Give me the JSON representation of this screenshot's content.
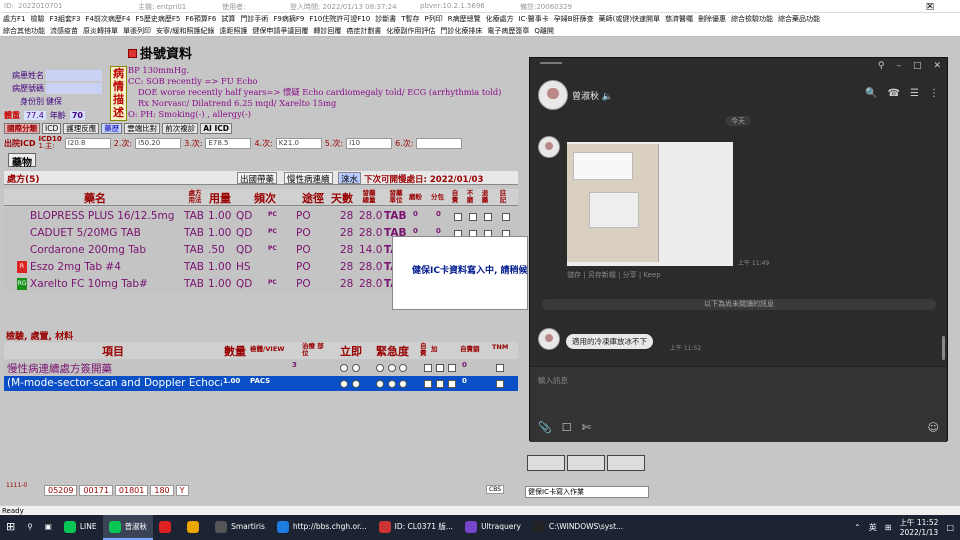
{
  "titlebar": {
    "id_label": "ID:",
    "id_val": "2022010701",
    "host": "主機: entpri01",
    "user": "使用者:",
    "login": "登入時間: 2022/01/13 08:37:24",
    "ver": "pbver:10.2.1.5696",
    "rec": "備註:20060329"
  },
  "menu": {
    "row1": [
      "處方F1",
      "檢驗",
      "F3組套F3",
      "F4前次病歷F4",
      "F5歷史病歷F5",
      "F6預算F6",
      "試算",
      "門診手術",
      "F9病摘F9",
      "F10住院許可證F10",
      "診斷書",
      "T暫存",
      "P列印",
      "R病歷總覽",
      "化療處方",
      "IC‧醫事卡",
      "孕婦B肝篩查",
      "藥師(或健)快速開單",
      "慈濟醫囑",
      "刪除優惠",
      "綜合檢驗功能",
      "綜合藥品功能"
    ],
    "row2": [
      "綜合其他功能",
      "流感疫苗",
      "原炎轉排單",
      "單張列印",
      "安寧/緩和照護紀錄",
      "遠距照護",
      "健保申請爭議回覆",
      "轉診回覆",
      "癌症計劃書",
      "化療副作用評估",
      "門診化療排床",
      "電子病歷簽章",
      "Q離開"
    ]
  },
  "form": {
    "title": "掛號資料"
  },
  "patient": {
    "name_label": "病患姓名",
    "chart_label": "病歷號碼",
    "id_label": "身份別",
    "id_value": "健保"
  },
  "vitals": {
    "ht_label": "體重",
    "ht": "77.4",
    "age_label": "年齡",
    "age": "70"
  },
  "soap": {
    "side": [
      "病",
      "情",
      "描",
      "述"
    ],
    "lines": [
      "BP 130mmHg.",
      "CC: SOB recently => FU Echo",
      "DOE worse recently half years=> 懷疑 Echo cardiomegaly told/ ECG (arrhythmia told)",
      "Rx  Norvasc/ Dilatrend 6.25 mqd/ Xarelto 15mg",
      "O: PH:   Smoking(-) , allergy(-)"
    ]
  },
  "icd_tabs": [
    "國際分類",
    "ICD",
    "護理反應",
    "藥歷",
    "雲端比對",
    "前次複診",
    "AI ICD"
  ],
  "icd": {
    "main_label": "出院ICD",
    "main_top": "ICD10",
    "main_sub": "1.主:",
    "main": "I20.8",
    "d2l": "2.次:",
    "d2": "I50.20",
    "d3l": "3.次:",
    "d3": "E78.5",
    "d4l": "4.次:",
    "d4": "K21.0",
    "d5l": "5.次:",
    "d5": "I10",
    "d6l": "6.次:",
    "d6": ""
  },
  "meds_tab": "藥物",
  "rx": {
    "label": "處方(5)",
    "btn1": "出國帶藥",
    "btn2": "慢性病連續",
    "btn3": "淶水",
    "due": "下次可開慢處日: 2022/01/03"
  },
  "rx_cols": {
    "name": "藥名",
    "route_hdr": "處方\n用法",
    "dose": "用量",
    "freq": "頻次",
    "route": "途徑",
    "days": "天數",
    "total": "發藥\n總量",
    "unit": "發藥\n單位",
    "powder": "磨粉",
    "split": "分包",
    "self": "自費",
    "self2": "不磨",
    "ref": "退藥",
    "note": "註\n記"
  },
  "rx_rows": [
    {
      "name": "BLOPRESS PLUS 16/12.5mg",
      "form": "TAB",
      "dose": "1.00",
      "freq": "QD",
      "pc": "PC",
      "route": "PO",
      "days": "28",
      "total": "28.0",
      "unit": "TAB",
      "p": "0",
      "s": "0",
      "tag": ""
    },
    {
      "name": "CADUET 5/20MG TAB",
      "form": "TAB",
      "dose": "1.00",
      "freq": "QD",
      "pc": "PC",
      "route": "PO",
      "days": "28",
      "total": "28.0",
      "unit": "TAB",
      "p": "0",
      "s": "0",
      "tag": ""
    },
    {
      "name": "Cordarone 200mg Tab",
      "form": "TAB",
      "dose": ".50",
      "freq": "QD",
      "pc": "PC",
      "route": "PO",
      "days": "28",
      "total": "14.0",
      "unit": "TA",
      "p": "",
      "s": "",
      "tag": ""
    },
    {
      "name": "Eszo 2mg Tab #4",
      "form": "TAB",
      "dose": "1.00",
      "freq": "HS",
      "pc": "",
      "route": "PO",
      "days": "28",
      "total": "28.0",
      "unit": "TA",
      "p": "",
      "s": "",
      "tag": "R"
    },
    {
      "name": "Xarelto FC 10mg Tab#",
      "form": "TAB",
      "dose": "1.00",
      "freq": "QD",
      "pc": "PC",
      "route": "PO",
      "days": "28",
      "total": "28.0",
      "unit": "TA",
      "p": "",
      "s": "",
      "tag": "RG"
    }
  ],
  "orders": {
    "label": "檢驗, 處置, 材料",
    "col_item": "項目",
    "col_qty": "數量",
    "col_view": "檢體/VIEW",
    "col_site": "治療\n部位",
    "col_stat": "立即",
    "col_urg": "緊急度",
    "col_self": "自費",
    "col_extra": "加",
    "col_fee": "自費額",
    "col_tnm": "TNM"
  },
  "order_rows": [
    {
      "item": "慢性病連續處方簽開藥",
      "qty": "",
      "view": "",
      "site": "3",
      "fee": "0",
      "selected": false
    },
    {
      "item": "(M-mode-sector-scan and Doppler Echoca",
      "qty": "1.00",
      "view": "PACS",
      "site": "",
      "fee": "0",
      "selected": true
    }
  ],
  "bottom": {
    "tiny": "1111-0",
    "nums": [
      "05209",
      "00171",
      "01801",
      "180",
      "Y"
    ],
    "cbs": "CBS"
  },
  "popup": {
    "text": "健保IC卡資料寫入中, 請稍候"
  },
  "ic_panel": {
    "label": "健保IC卡寫入作業"
  },
  "line": {
    "contact": "曾淑秋",
    "today": "今天",
    "img_time": "上午 11:49",
    "img_actions": "儲存 | 另存新檔 | 分享 | Keep",
    "unread": "以下為尚未閱讀的訊息",
    "msg": "適用的冷凍庫放冰不下",
    "msg_time": "上午 11:52",
    "input_placeholder": "輸入訊息"
  },
  "status": {
    "text": "Ready"
  },
  "taskbar": {
    "apps": [
      {
        "label": "LINE",
        "color": "#06c755",
        "active": false
      },
      {
        "label": "曾淑秋",
        "color": "#06c755",
        "active": true
      },
      {
        "label": "",
        "color": "#d22",
        "active": false
      },
      {
        "label": "",
        "color": "#e9a700",
        "active": false
      },
      {
        "label": "Smartiris",
        "color": "#555",
        "active": false
      },
      {
        "label": "http://bbs.chgh.or...",
        "color": "#1e7be0",
        "active": false
      },
      {
        "label": "ID: CL0371  版...",
        "color": "#c33",
        "active": false
      },
      {
        "label": "Ultraquery",
        "color": "#7744cc",
        "active": false
      },
      {
        "label": "C:\\WINDOWS\\syst...",
        "color": "#222",
        "active": false
      }
    ],
    "ime": "英",
    "time": "上午 11:52",
    "date": "2022/1/13"
  }
}
